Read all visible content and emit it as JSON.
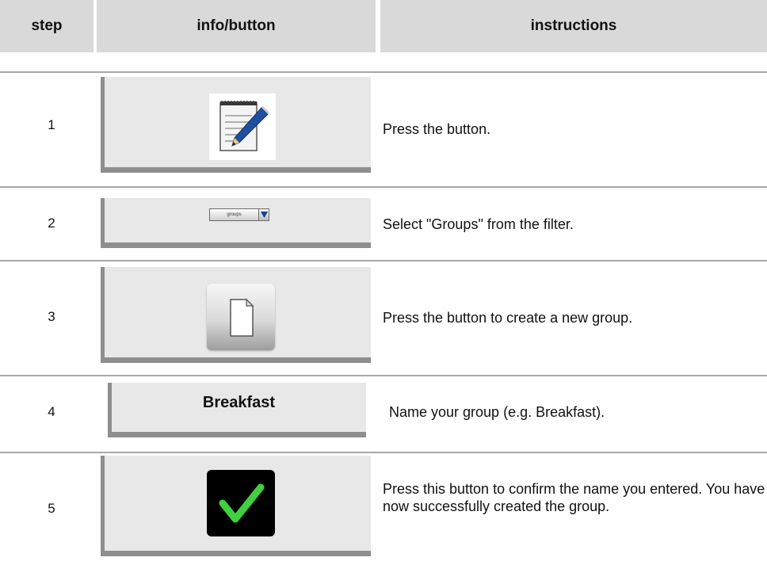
{
  "header": {
    "step": "step",
    "info": "info/button",
    "instructions": "instructions"
  },
  "steps": [
    {
      "num": "1",
      "icon": "notepad-pencil-icon",
      "instruction": "Press the button."
    },
    {
      "num": "2",
      "icon": "filter-dropdown",
      "dropdown_value": "groups",
      "instruction": "Select \"Groups\" from the filter."
    },
    {
      "num": "3",
      "icon": "new-document-icon",
      "instruction": "Press the button to create a new group."
    },
    {
      "num": "4",
      "name_value": "Breakfast",
      "instruction": "Name your group (e.g. Breakfast)."
    },
    {
      "num": "5",
      "icon": "checkmark-icon",
      "check_color": "#3fcf3f",
      "instruction": "Press this button to confirm the name you entered. You have now successfully created the group."
    }
  ]
}
